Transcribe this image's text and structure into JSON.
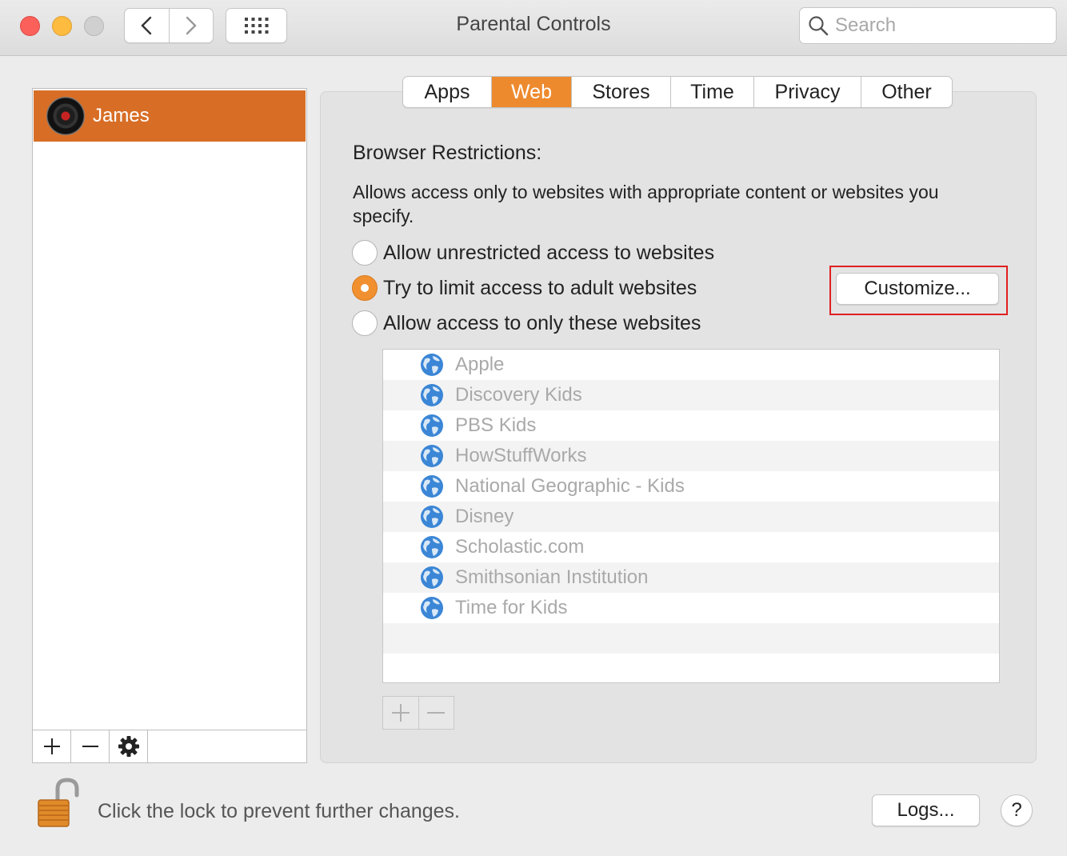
{
  "window": {
    "title": "Parental Controls",
    "search_placeholder": "Search"
  },
  "sidebar": {
    "users": [
      {
        "name": "James",
        "selected": true
      }
    ]
  },
  "tabs": [
    {
      "label": "Apps",
      "active": false
    },
    {
      "label": "Web",
      "active": true
    },
    {
      "label": "Stores",
      "active": false
    },
    {
      "label": "Time",
      "active": false
    },
    {
      "label": "Privacy",
      "active": false
    },
    {
      "label": "Other",
      "active": false
    }
  ],
  "web": {
    "heading": "Browser Restrictions:",
    "description": "Allows access only to websites with appropriate content or websites you specify.",
    "options": [
      {
        "label": "Allow unrestricted access to websites",
        "selected": false
      },
      {
        "label": "Try to limit access to adult websites",
        "selected": true
      },
      {
        "label": "Allow access to only these websites",
        "selected": false
      }
    ],
    "customize_label": "Customize...",
    "sites": [
      "Apple",
      "Discovery Kids",
      "PBS Kids",
      "HowStuffWorks",
      "National Geographic - Kids",
      "Disney",
      "Scholastic.com",
      "Smithsonian Institution",
      "Time for Kids"
    ]
  },
  "footer": {
    "lock_text": "Click the lock to prevent further changes.",
    "logs_label": "Logs...",
    "help_label": "?"
  },
  "colors": {
    "accent": "#ee8a2e",
    "selected_user": "#d86e26",
    "highlight": "#e02020"
  }
}
